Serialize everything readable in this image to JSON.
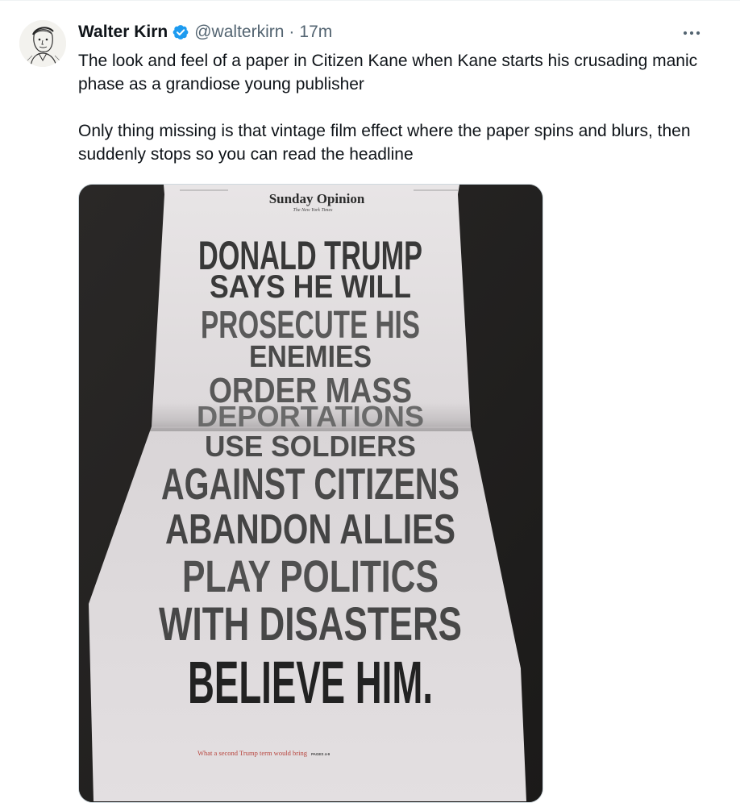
{
  "tweet": {
    "author_name": "Walter Kirn",
    "handle": "@walterkirn",
    "separator": "·",
    "time": "17m",
    "text_paragraph_1": "The look and feel of a paper in Citizen Kane when Kane starts his crusading manic phase as a grandiose young publisher",
    "text_paragraph_2": "Only thing missing is that vintage film effect where the paper spins and blurs, then suddenly stops so you can read the headline",
    "more_label": "···"
  },
  "icons": {
    "verified": "verified-badge-icon",
    "more": "more-options-icon",
    "avatar": "avatar-sketch"
  },
  "colors": {
    "verified_blue": "#1d9bf0",
    "secondary_text": "#536471",
    "headline_ink": "#2b2b2b",
    "tagline_red": "#b8453e"
  },
  "newspaper": {
    "masthead": "Sunday Opinion",
    "nameplate": "The New York Times",
    "headline_lines": [
      "DONALD TRUMP",
      "SAYS HE WILL",
      "PROSECUTE HIS",
      "ENEMIES",
      "ORDER MASS",
      "DEPORTATIONS",
      "USE SOLDIERS",
      "AGAINST CITIZENS",
      "ABANDON ALLIES",
      "PLAY POLITICS",
      "WITH DISASTERS",
      "BELIEVE HIM."
    ],
    "tagline": "What a second Trump term would bring",
    "pages": "PAGES 4-9"
  }
}
